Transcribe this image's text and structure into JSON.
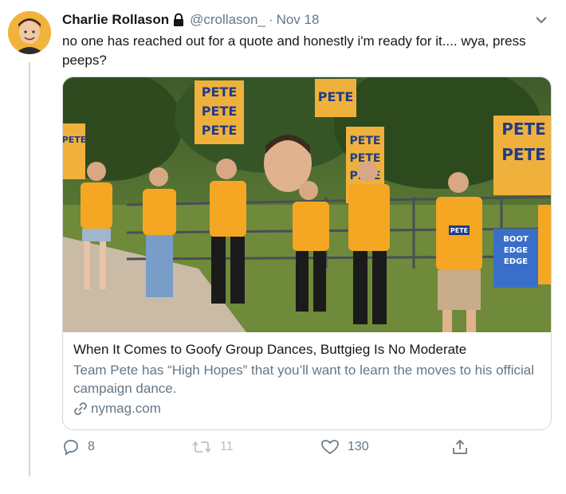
{
  "tweet": {
    "author_name": "Charlie Rollason",
    "handle": "@crollason_",
    "separator": "·",
    "date": "Nov 18",
    "text": "no one has reached out for a quote and honestly i'm ready for it.... wya, press peeps?"
  },
  "card": {
    "title": "When It Comes to Goofy Group Dances, Buttgieg Is No Moderate",
    "description": "Team Pete has “High Hopes” that you’ll want to learn the moves to his official campaign dance.",
    "domain": "nymag.com",
    "image": {
      "signs": [
        "PETE",
        "PETE",
        "PETE",
        "PETE",
        "PETE",
        "PETE",
        "PETE",
        "PETE",
        "PETE",
        "PETE"
      ],
      "sign_small": [
        "BOOT",
        "EDGE",
        "EDGE"
      ],
      "shirt_label": "PETE"
    }
  },
  "actions": {
    "reply_count": "8",
    "retweet_count": "11",
    "like_count": "130"
  },
  "colors": {
    "accent_text": "#657786",
    "shirt": "#f5a623",
    "sign": "#f0b13c",
    "sign_text": "#1f3c88"
  }
}
